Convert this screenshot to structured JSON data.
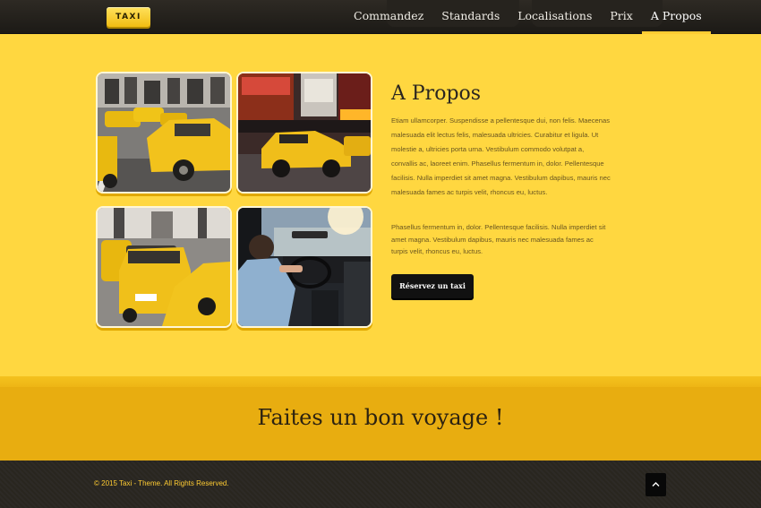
{
  "header": {
    "logo_text": "TAXI",
    "nav": [
      {
        "label": "Commandez"
      },
      {
        "label": "Standards"
      },
      {
        "label": "Localisations"
      },
      {
        "label": "Prix"
      },
      {
        "label": "A Propos",
        "active": true
      }
    ]
  },
  "about": {
    "title": "A Propos",
    "paragraph1": "Etiam ullamcorper. Suspendisse a pellentesque dui, non felis. Maecenas malesuada elit lectus felis, malesuada ultricies. Curabitur et ligula. Ut molestie a, ultricies porta urna. Vestibulum commodo volutpat a, convallis ac, laoreet enim. Phasellus fermentum in, dolor. Pellentesque facilisis. Nulla imperdiet sit amet magna. Vestibulum dapibus, mauris nec malesuada fames ac turpis velit, rhoncus eu, luctus.",
    "paragraph2": "Phasellus fermentum in, dolor. Pellentesque facilisis. Nulla imperdiet sit amet magna. Vestibulum dapibus, mauris nec malesuada fames ac turpis velit, rhoncus eu, luctus.",
    "button_label": "Réservez un taxi",
    "images": [
      {
        "icon": "taxi-street-photo"
      },
      {
        "icon": "times-square-taxi-photo"
      },
      {
        "icon": "taxi-traffic-photo"
      },
      {
        "icon": "driver-interior-photo"
      }
    ]
  },
  "banner": {
    "text": "Faites un bon voyage !"
  },
  "footer": {
    "copyright": "© 2015 Taxi - Theme. All Rights Reserved.",
    "back_to_top_icon": "chevron-up-icon"
  },
  "colors": {
    "page_bg": "#ffd740",
    "header_bg": "#1f1d19",
    "banner_bg": "#e8ad10",
    "footer_bg": "#2b2823",
    "accent": "#ffcc33",
    "button_bg": "#111111"
  }
}
